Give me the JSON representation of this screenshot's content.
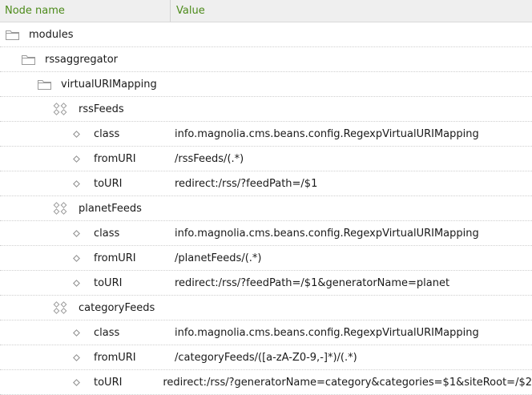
{
  "header": {
    "name_label": "Node name",
    "value_label": "Value"
  },
  "rows": [
    {
      "name": "modules",
      "value": "",
      "icon": "folder-icon"
    },
    {
      "name": "rssaggregator",
      "value": "",
      "icon": "folder-icon"
    },
    {
      "name": "virtualURIMapping",
      "value": "",
      "icon": "folder-icon"
    },
    {
      "name": "rssFeeds",
      "value": "",
      "icon": "content-node-icon"
    },
    {
      "name": "class",
      "value": "info.magnolia.cms.beans.config.RegexpVirtualURIMapping",
      "icon": "property-icon"
    },
    {
      "name": "fromURI",
      "value": "/rssFeeds/(.*)",
      "icon": "property-icon"
    },
    {
      "name": "toURI",
      "value": "redirect:/rss/?feedPath=/$1",
      "icon": "property-icon"
    },
    {
      "name": "planetFeeds",
      "value": "",
      "icon": "content-node-icon"
    },
    {
      "name": "class",
      "value": "info.magnolia.cms.beans.config.RegexpVirtualURIMapping",
      "icon": "property-icon"
    },
    {
      "name": "fromURI",
      "value": "/planetFeeds/(.*)",
      "icon": "property-icon"
    },
    {
      "name": "toURI",
      "value": "redirect:/rss/?feedPath=/$1&generatorName=planet",
      "icon": "property-icon"
    },
    {
      "name": "categoryFeeds",
      "value": "",
      "icon": "content-node-icon"
    },
    {
      "name": "class",
      "value": "info.magnolia.cms.beans.config.RegexpVirtualURIMapping",
      "icon": "property-icon"
    },
    {
      "name": "fromURI",
      "value": "/categoryFeeds/([a-zA-Z0-9,-]*)/(.*)",
      "icon": "property-icon"
    },
    {
      "name": "toURI",
      "value": "redirect:/rss/?generatorName=category&categories=$1&siteRoot=/$2",
      "icon": "property-icon"
    }
  ]
}
